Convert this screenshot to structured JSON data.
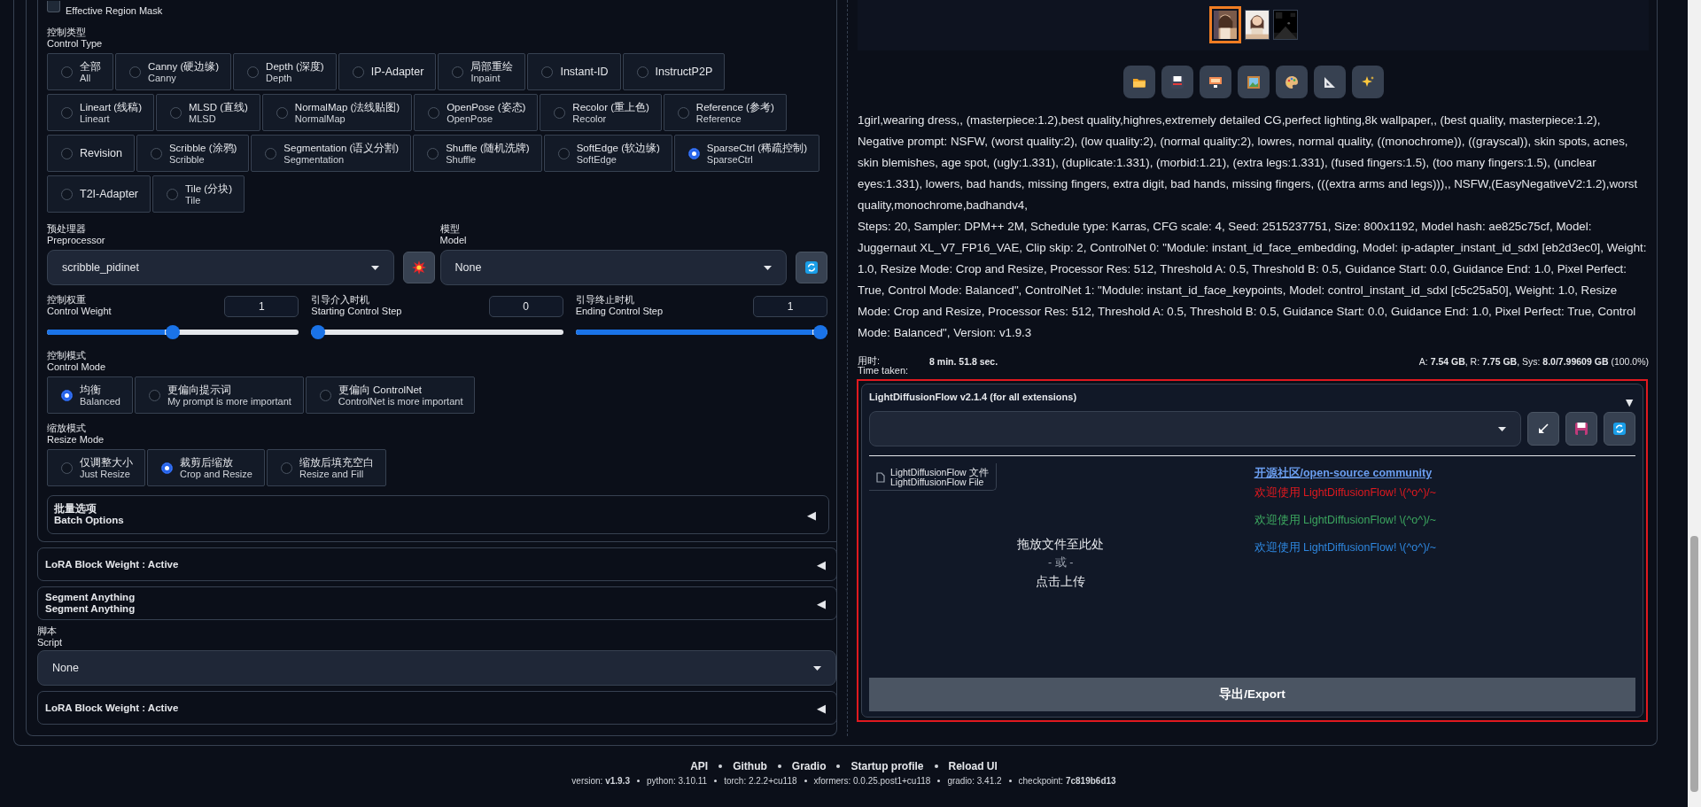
{
  "region_mask": {
    "label": "Effective Region Mask",
    "checked": false
  },
  "control_type": {
    "label": "控制类型",
    "sublabel": "Control Type",
    "options": [
      {
        "label": "全部",
        "sublabel": "All",
        "selected": false
      },
      {
        "label": "Canny (硬边缘)",
        "sublabel": "Canny",
        "selected": false
      },
      {
        "label": "Depth (深度)",
        "sublabel": "Depth",
        "selected": false
      },
      {
        "label": "IP-Adapter",
        "selected": false
      },
      {
        "label": "局部重绘",
        "sublabel": "Inpaint",
        "selected": false
      },
      {
        "label": "Instant-ID",
        "selected": false
      },
      {
        "label": "InstructP2P",
        "selected": false
      },
      {
        "label": "Lineart (线稿)",
        "sublabel": "Lineart",
        "selected": false
      },
      {
        "label": "MLSD (直线)",
        "sublabel": "MLSD",
        "selected": false
      },
      {
        "label": "NormalMap (法线贴图)",
        "sublabel": "NormalMap",
        "selected": false
      },
      {
        "label": "OpenPose (姿态)",
        "sublabel": "OpenPose",
        "selected": false
      },
      {
        "label": "Recolor (重上色)",
        "sublabel": "Recolor",
        "selected": false
      },
      {
        "label": "Reference (参考)",
        "sublabel": "Reference",
        "selected": false
      },
      {
        "label": "Revision",
        "selected": false
      },
      {
        "label": "Scribble (涂鸦)",
        "sublabel": "Scribble",
        "selected": false
      },
      {
        "label": "Segmentation (语义分割)",
        "sublabel": "Segmentation",
        "selected": false
      },
      {
        "label": "Shuffle (随机洗牌)",
        "sublabel": "Shuffle",
        "selected": false
      },
      {
        "label": "SoftEdge (软边缘)",
        "sublabel": "SoftEdge",
        "selected": false
      },
      {
        "label": "SparseCtrl (稀疏控制)",
        "sublabel": "SparseCtrl",
        "selected": true
      },
      {
        "label": "T2I-Adapter",
        "selected": false
      },
      {
        "label": "Tile (分块)",
        "sublabel": "Tile",
        "selected": false
      }
    ]
  },
  "preprocessor": {
    "label": "预处理器",
    "sublabel": "Preprocessor",
    "value": "scribble_pidinet"
  },
  "model": {
    "label": "模型",
    "sublabel": "Model",
    "value": "None"
  },
  "sliders": [
    {
      "label": "控制权重",
      "sublabel": "Control Weight",
      "value": "1",
      "level": 0.5
    },
    {
      "label": "引导介入时机",
      "sublabel": "Starting Control Step",
      "value": "0",
      "level": 0
    },
    {
      "label": "引导终止时机",
      "sublabel": "Ending Control Step",
      "value": "1",
      "level": 1
    }
  ],
  "control_mode": {
    "label": "控制模式",
    "sublabel": "Control Mode",
    "options": [
      {
        "label": "均衡",
        "sublabel": "Balanced",
        "selected": true
      },
      {
        "label": "更偏向提示词",
        "sublabel": "My prompt is more important",
        "selected": false
      },
      {
        "label": "更偏向 ControlNet",
        "sublabel": "ControlNet is more important",
        "selected": false
      }
    ]
  },
  "resize_mode": {
    "label": "缩放模式",
    "sublabel": "Resize Mode",
    "options": [
      {
        "label": "仅调整大小",
        "sublabel": "Just Resize",
        "selected": false
      },
      {
        "label": "裁剪后缩放",
        "sublabel": "Crop and Resize",
        "selected": true
      },
      {
        "label": "缩放后填充空白",
        "sublabel": "Resize and Fill",
        "selected": false
      }
    ]
  },
  "batch_options": {
    "title": "批量选项",
    "subtitle": "Batch Options",
    "arrow": "◀"
  },
  "accordions": [
    {
      "title": "LoRA Block Weight : Active",
      "arrow": "◀"
    },
    {
      "title": "Segment Anything",
      "subtitle": "Segment Anything",
      "arrow": "◀"
    }
  ],
  "script": {
    "label": "脚本",
    "sublabel": "Script",
    "value": "None"
  },
  "accordions_after": [
    {
      "title": "LoRA Block Weight : Active",
      "arrow": "◀"
    }
  ],
  "gallery": {
    "thumbnails": [
      {
        "kind": "picture",
        "selected": true
      },
      {
        "kind": "picture",
        "selected": false
      },
      {
        "kind": "picture",
        "selected": false
      }
    ]
  },
  "generation_info": [
    "1girl,wearing dress,, (masterpiece:1.2),best quality,highres,extremely detailed CG,perfect lighting,8k wallpaper,, (best quality, masterpiece:1.2),",
    "Negative prompt: NSFW, (worst quality:2), (low quality:2), (normal quality:2), lowres, normal quality, ((monochrome)), ((grayscal)), skin spots, acnes, skin blemishes, age spot, (ugly:1.331), (duplicate:1.331), (morbid:1.21), (extra legs:1.331), (fused fingers:1.5), (too many fingers:1.5), (unclear eyes:1.331), lowers, bad hands, missing fingers, extra digit, bad hands, missing fingers, (((extra arms and legs))),, NSFW,(EasyNegativeV2:1.2),worst quality,monochrome,badhandv4,",
    "Steps: 20, Sampler: DPM++ 2M, Schedule type: Karras, CFG scale: 4, Seed: 2515237751, Size: 800x1192, Model hash: ae825c75cf, Model: Juggernaut XL_V7_FP16_VAE, Clip skip: 2, ControlNet 0: \"Module: instant_id_face_embedding, Model: ip-adapter_instant_id_sdxl [eb2d3ec0], Weight: 1.0, Resize Mode: Crop and Resize, Processor Res: 512, Threshold A: 0.5, Threshold B: 0.5, Guidance Start: 0.0, Guidance End: 1.0, Pixel Perfect: True, Control Mode: Balanced\", ControlNet 1: \"Module: instant_id_face_keypoints, Model: control_instant_id_sdxl [c5c25a50], Weight: 1.0, Resize Mode: Crop and Resize, Processor Res: 512, Threshold A: 0.5, Threshold B: 0.5, Guidance Start: 0.0, Guidance End: 1.0, Pixel Perfect: True, Control Mode: Balanced\", Version: v1.9.3"
  ],
  "time_taken": {
    "label": "用时:",
    "sublabel": "Time taken:",
    "value": "8 min. 51.8 sec."
  },
  "memory": "A: **7.54 GB**, R: **7.75 GB**, Sys: **8.0/7.99609 GB** (100.0%)",
  "flow": {
    "title": "LightDiffusionFlow v2.1.4 (for all extensions)",
    "arrow": "▼",
    "file_label": "LightDiffusionFlow 文件",
    "file_sublabel": "LightDiffusionFlow File",
    "drop_lines": [
      "拖放文件至此处",
      "- 或 -",
      "点击上传"
    ],
    "community_link": "开源社区/open-source community",
    "welcome": [
      {
        "text": "欢迎使用 LightDiffusionFlow! \\(^o^)/~",
        "color": "#e0191f"
      },
      {
        "text": "欢迎使用 LightDiffusionFlow! \\(^o^)/~",
        "color": "#3ca65f"
      },
      {
        "text": "欢迎使用 LightDiffusionFlow! \\(^o^)/~",
        "color": "#2e86de"
      }
    ],
    "export": "导出/Export"
  },
  "footer": {
    "links": [
      "API",
      "Github",
      "Gradio",
      "Startup profile",
      "Reload UI"
    ],
    "versions": [
      "version: **v1.9.3**",
      "python: 3.10.11",
      "torch: 2.2.2+cu118",
      "xformers: 0.0.25.post1+cu118",
      "gradio: 3.41.2",
      "checkpoint: **7c819b6d13**"
    ]
  }
}
